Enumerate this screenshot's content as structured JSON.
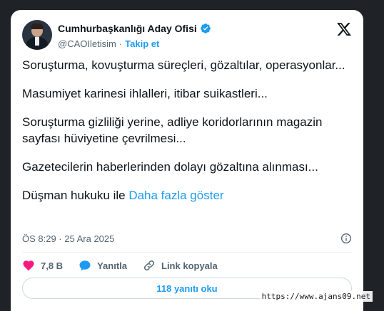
{
  "author": {
    "display_name": "Cumhurbaşkanlığı Aday Ofisi",
    "handle": "@CAOIletisim",
    "separator": "·",
    "follow_label": "Takip et"
  },
  "tweet": {
    "paragraphs": [
      "Soruşturma, kovuşturma süreçleri, gözaltılar, operasyonlar...",
      "Masumiyet karinesi ihlalleri, itibar suikastleri...",
      "Soruşturma gizliliği yerine, adliye koridorlarının magazin sayfası hüviyetine çevrilmesi...",
      "Gazetecilerin haberlerinden dolayı gözaltına alınması..."
    ],
    "last_line": "Düşman hukuku ile",
    "show_more": "Daha fazla göster",
    "timestamp": "ÖS 8:29 · 25 Ara 2025"
  },
  "actions": {
    "likes": "7,8 B",
    "reply_label": "Yanıtla",
    "copy_link_label": "Link kopyala",
    "read_replies": "118 yanıtı oku"
  },
  "watermark": "https://www.ajans09.net",
  "colors": {
    "accent": "#1d9bf0",
    "like": "#f91880",
    "text": "#0f1419",
    "muted": "#536471"
  },
  "icons": [
    "verified-icon",
    "x-logo-icon",
    "info-icon",
    "heart-icon",
    "reply-icon",
    "link-icon"
  ]
}
